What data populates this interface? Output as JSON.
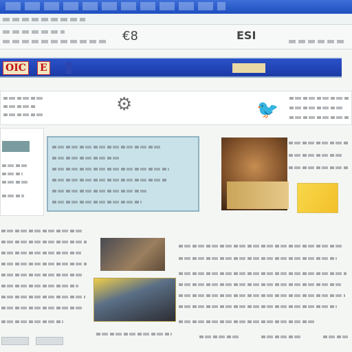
{
  "window": {
    "title": ""
  },
  "banner": {
    "logo_a": "OIC",
    "logo_b": "E",
    "title": "",
    "link": ""
  },
  "toolbar": {
    "btn_left_glyph": "€8",
    "btn_right_glyph": "ESI"
  },
  "feature": {
    "caption": ""
  },
  "icons": [
    "gear-icon",
    "bird-icon",
    "photo-icon"
  ],
  "colors": {
    "banner": "#1b3aa6",
    "accent": "#ffe25a",
    "feature_bg": "#c9e2ea"
  }
}
